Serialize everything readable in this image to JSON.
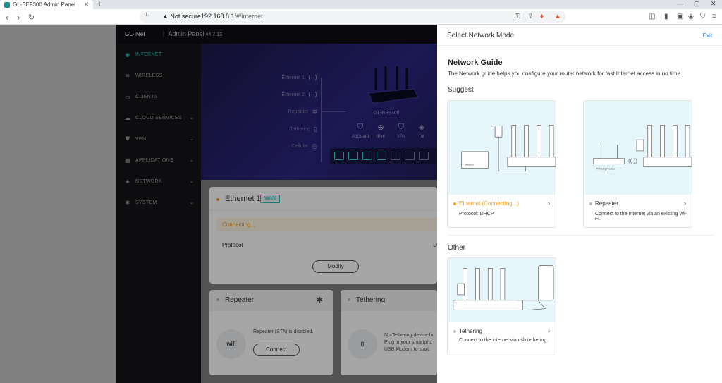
{
  "browser": {
    "tab_title": "GL-BE9300 Admin Panel",
    "security": "Not secure",
    "url_host": "192.168.8.1",
    "url_path": "/#/internet"
  },
  "header": {
    "logo": "GL·iNet",
    "title": "Admin Panel",
    "version": "v4.7.13"
  },
  "sidebar": {
    "items": [
      {
        "label": "INTERNET",
        "icon": "globe-icon"
      },
      {
        "label": "WIRELESS",
        "icon": "wifi-icon"
      },
      {
        "label": "CLIENTS",
        "icon": "clients-icon"
      },
      {
        "label": "CLOUD SERVICES",
        "icon": "cloud-icon"
      },
      {
        "label": "VPN",
        "icon": "shield-icon"
      },
      {
        "label": "APPLICATIONS",
        "icon": "apps-icon"
      },
      {
        "label": "NETWORK",
        "icon": "network-icon"
      },
      {
        "label": "SYSTEM",
        "icon": "gear-icon"
      }
    ]
  },
  "hero": {
    "connections": [
      "Ethernet 1",
      "Ethernet 2",
      "Repeater",
      "Tethering",
      "Cellular"
    ],
    "model": "GL-BE9300",
    "features": [
      "AdGuard",
      "IPv6",
      "VPN",
      "Tor"
    ]
  },
  "ethernet_card": {
    "title": "Ethernet 1",
    "badge": "WAN",
    "status": "Connecting...",
    "protocol_label": "Protocol",
    "protocol_value": "D",
    "modify": "Modify"
  },
  "repeater_card": {
    "title": "Repeater",
    "icon_text": "wifi",
    "status": "Repeater (STA) is disabled.",
    "connect": "Connect"
  },
  "tethering_card": {
    "title": "Tethering",
    "line1": "No Tethering device fo",
    "line2": "Plug in your smartpho",
    "line3": "USB Modem to start."
  },
  "drawer": {
    "title": "Select Network Mode",
    "exit": "Exit",
    "guide_title": "Network Guide",
    "guide_desc": "The Network guide helps you configure your router network for fast Internet access in no time.",
    "suggest": "Suggest",
    "other": "Other",
    "options": [
      {
        "label": "Ethernet (Connecting...)",
        "sub": "Protocol: DHCP",
        "color": "#f0a020"
      },
      {
        "label": "Repeater",
        "sub": "Connect to the Internet via an existing Wi-Fi.",
        "color": "#bbbbbb"
      },
      {
        "label": "Tethering",
        "sub": "Connect to the internet via usb tethering.",
        "color": "#bbbbbb"
      }
    ],
    "illustration_labels": [
      "Modem",
      "Primary Router"
    ]
  }
}
